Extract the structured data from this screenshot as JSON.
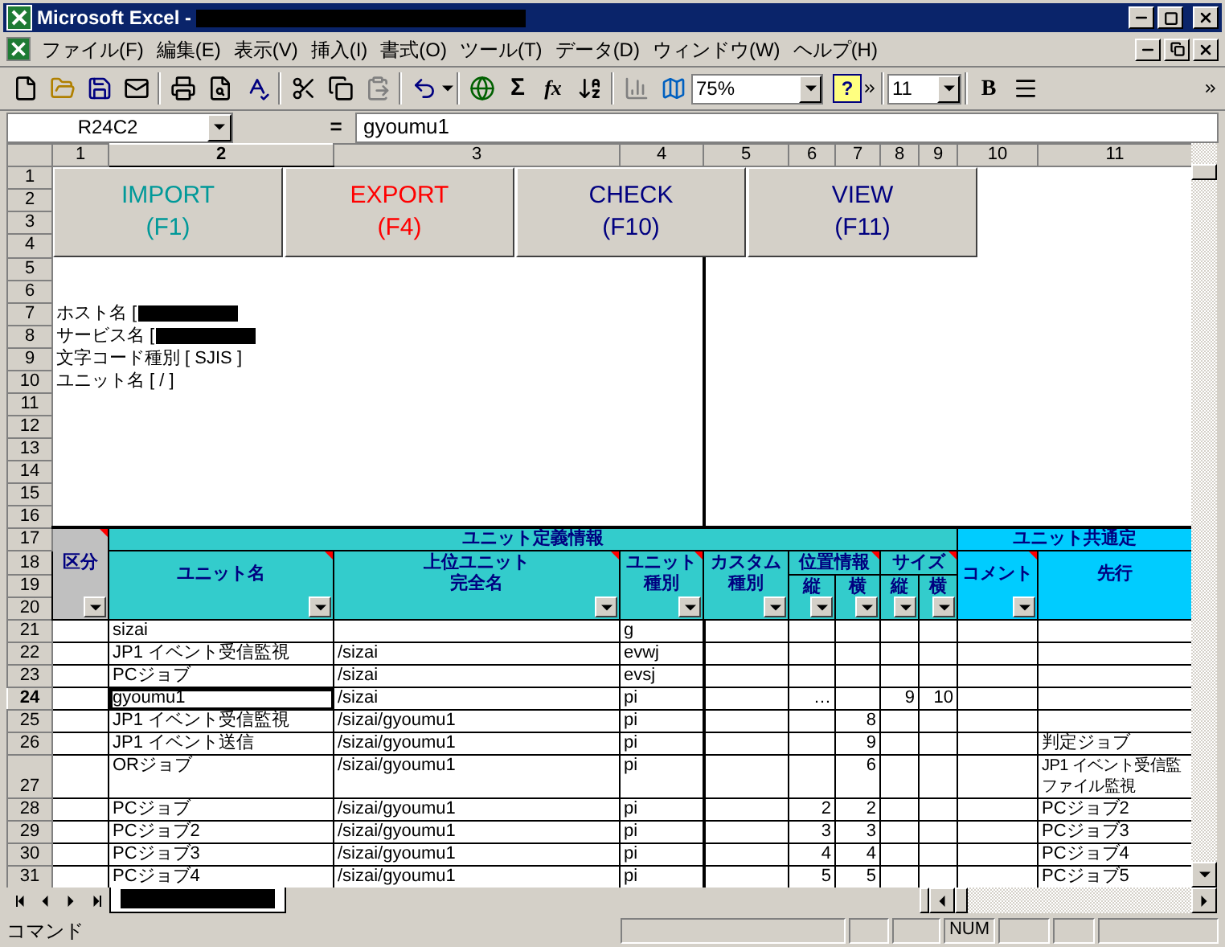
{
  "window": {
    "title": "Microsoft Excel -",
    "title_redacted": true
  },
  "menu": [
    "ファイル(F)",
    "編集(E)",
    "表示(V)",
    "挿入(I)",
    "書式(O)",
    "ツール(T)",
    "データ(D)",
    "ウィンドウ(W)",
    "ヘルプ(H)"
  ],
  "toolbar": {
    "sigma": "Σ",
    "fx": "fx",
    "zoom": "75%",
    "help": "?",
    "font_size": "11",
    "bold": "B"
  },
  "formula_bar": {
    "name_box": "R24C2",
    "equals": "=",
    "value": "gyoumu1"
  },
  "sheet": {
    "column_headers": [
      {
        "label": "1",
        "selected": false
      },
      {
        "label": "2",
        "selected": true
      },
      {
        "label": "3",
        "selected": false
      },
      {
        "label": "4",
        "selected": false
      },
      {
        "label": "5",
        "selected": false
      },
      {
        "label": "6",
        "selected": false
      },
      {
        "label": "7",
        "selected": false
      },
      {
        "label": "8",
        "selected": false
      },
      {
        "label": "9",
        "selected": false
      },
      {
        "label": "10",
        "selected": false
      },
      {
        "label": "11",
        "selected": false
      }
    ],
    "top_rows": [
      "1",
      "2",
      "3",
      "4",
      "5",
      "6",
      "7",
      "8",
      "9",
      "10",
      "11",
      "12",
      "13",
      "14",
      "15",
      "16"
    ],
    "buttons": [
      {
        "label": "IMPORT",
        "key": "(F1)",
        "color": "#009999"
      },
      {
        "label": "EXPORT",
        "key": "(F4)",
        "color": "#ff0000"
      },
      {
        "label": "CHECK",
        "key": "(F10)",
        "color": "#000080"
      },
      {
        "label": "VIEW",
        "key": "(F11)",
        "color": "#000080"
      }
    ],
    "info_lines": [
      {
        "text": "ホスト名 [",
        "redacted": true
      },
      {
        "text": "サービス名 [",
        "redacted": true
      },
      {
        "text": "文字コード種別 [ SJIS ]",
        "redacted": false
      },
      {
        "text": "ユニット名 [ / ]",
        "redacted": false
      }
    ],
    "header_rows": [
      "17",
      "18",
      "19",
      "20"
    ],
    "table_header": {
      "corner": {
        "lines": [
          "区分"
        ],
        "comment": true,
        "filter": true
      },
      "groups": [
        {
          "label": "ユニット定義情報",
          "color": "#33cccc",
          "columns": [
            {
              "lines": [
                "ユニット名"
              ],
              "comment": true,
              "filter": true
            },
            {
              "lines": [
                "上位ユニット",
                "完全名"
              ],
              "comment": true,
              "filter": true
            },
            {
              "lines": [
                "ユニット",
                "種別"
              ],
              "comment": true,
              "filter": true
            },
            {
              "lines": [
                "カスタム",
                "種別"
              ],
              "comment": false,
              "filter": true
            },
            {
              "lines": [
                "位置情報"
              ],
              "comment": true,
              "sub": [
                {
                  "lines": [
                    "縦"
                  ],
                  "filter": true
                },
                {
                  "lines": [
                    "横"
                  ],
                  "filter": true
                }
              ]
            },
            {
              "lines": [
                "サイズ"
              ],
              "comment": true,
              "sub": [
                {
                  "lines": [
                    "縦"
                  ],
                  "filter": true
                },
                {
                  "lines": [
                    "横"
                  ],
                  "filter": true
                }
              ]
            }
          ]
        },
        {
          "label": "ユニット共通定",
          "color": "#00ccff",
          "columns": [
            {
              "lines": [
                "コメント"
              ],
              "comment": true,
              "filter": true
            },
            {
              "lines": [
                "先行"
              ],
              "comment": false,
              "filter": false
            }
          ]
        }
      ]
    },
    "rows": [
      {
        "row": "21",
        "selected": false,
        "cells": [
          "",
          "sizai",
          "",
          "g",
          "",
          "",
          "",
          "",
          "",
          "",
          ""
        ]
      },
      {
        "row": "22",
        "selected": false,
        "cells": [
          "",
          "JP1 イベント受信監視",
          "/sizai",
          "evwj",
          "",
          "",
          "",
          "",
          "",
          "",
          ""
        ]
      },
      {
        "row": "23",
        "selected": false,
        "cells": [
          "",
          "PCジョブ",
          "/sizai",
          "evsj",
          "",
          "",
          "",
          "",
          "",
          "",
          ""
        ]
      },
      {
        "row": "24",
        "selected": true,
        "cells": [
          "",
          "gyoumu1",
          "/sizai",
          "pi",
          "",
          "…",
          "",
          "9",
          "10",
          "",
          ""
        ]
      },
      {
        "row": "25",
        "selected": false,
        "cells": [
          "",
          "JP1 イベント受信監視",
          "/sizai/gyoumu1",
          "pi",
          "",
          "",
          "8",
          "",
          "",
          "",
          ""
        ]
      },
      {
        "row": "26",
        "selected": false,
        "cells": [
          "",
          "JP1 イベント送信",
          "/sizai/gyoumu1",
          "pi",
          "",
          "",
          "9",
          "",
          "",
          "",
          "判定ジョブ"
        ]
      },
      {
        "row": "27",
        "selected": false,
        "cells": [
          "",
          "ORジョブ",
          "/sizai/gyoumu1",
          "pi",
          "",
          "",
          "6",
          "",
          "",
          "",
          [
            "JP1 イベント受信監",
            "ファイル監視"
          ]
        ]
      },
      {
        "row": "28",
        "selected": false,
        "cells": [
          "",
          "PCジョブ",
          "/sizai/gyoumu1",
          "pi",
          "",
          "2",
          "2",
          "",
          "",
          "",
          "PCジョブ2"
        ]
      },
      {
        "row": "29",
        "selected": false,
        "cells": [
          "",
          "PCジョブ2",
          "/sizai/gyoumu1",
          "pi",
          "",
          "3",
          "3",
          "",
          "",
          "",
          "PCジョブ3"
        ]
      },
      {
        "row": "30",
        "selected": false,
        "cells": [
          "",
          "PCジョブ3",
          "/sizai/gyoumu1",
          "pi",
          "",
          "4",
          "4",
          "",
          "",
          "",
          "PCジョブ4"
        ]
      },
      {
        "row": "31",
        "selected": false,
        "cells": [
          "",
          "PCジョブ4",
          "/sizai/gyoumu1",
          "pi",
          "",
          "5",
          "5",
          "",
          "",
          "",
          "PCジョブ5"
        ]
      }
    ],
    "sheet_tab": {
      "redacted": true
    }
  },
  "status_bar": {
    "mode": "コマンド",
    "num": "NUM"
  }
}
